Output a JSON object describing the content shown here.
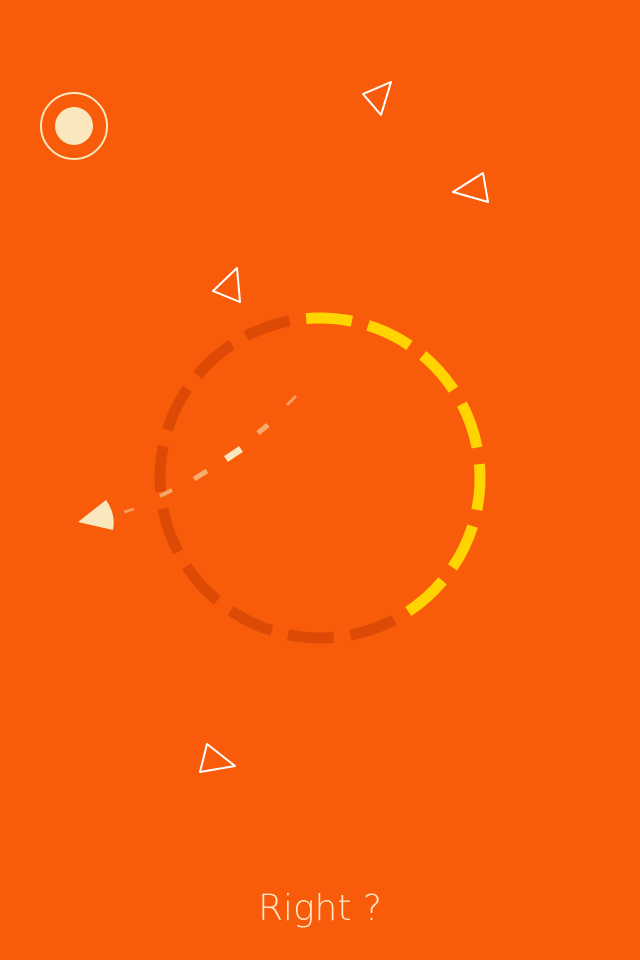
{
  "game": {
    "prompt_text": "Right ?",
    "colors": {
      "background": "#F85C0A",
      "ring_active": "#FFD400",
      "ring_inactive": "#DD4A06",
      "cream": "#FBE7BE",
      "outline": "#FFFFFF",
      "trail": "#F6B67A"
    },
    "ring": {
      "segments_total": 16,
      "segments_lit": 7
    },
    "pause_icon": "record-pause-icon"
  }
}
